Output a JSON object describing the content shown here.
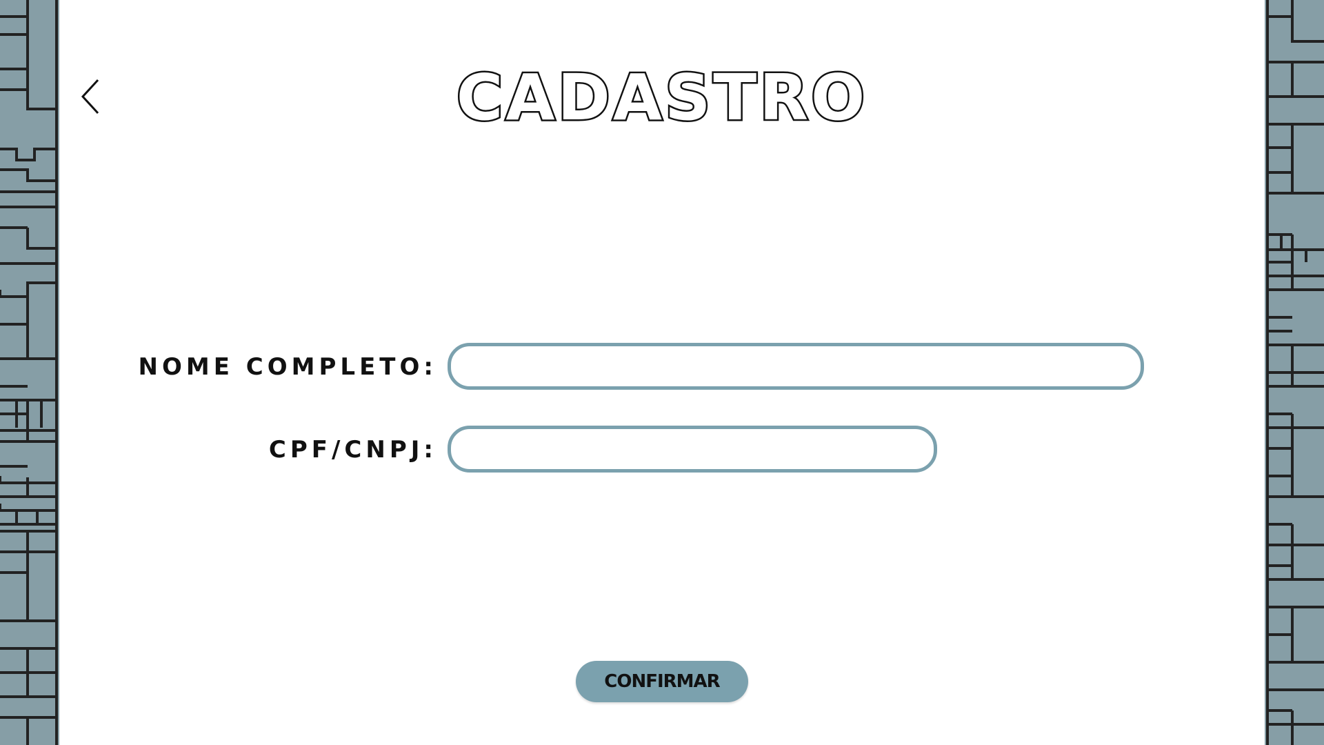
{
  "header": {
    "title": "CADASTRO",
    "back_icon": "chevron-left-icon"
  },
  "form": {
    "fields": [
      {
        "label": "NOME COMPLETO:",
        "value": "",
        "placeholder": ""
      },
      {
        "label": "CPF/CNPJ:",
        "value": "",
        "placeholder": ""
      }
    ]
  },
  "actions": {
    "confirm_label": "CONFIRMAR"
  },
  "theme": {
    "accent": "#7ba1ae",
    "border_pattern_fill": "#869ea6",
    "border_pattern_lines": "#222222",
    "text": "#111111",
    "background": "#ffffff"
  }
}
